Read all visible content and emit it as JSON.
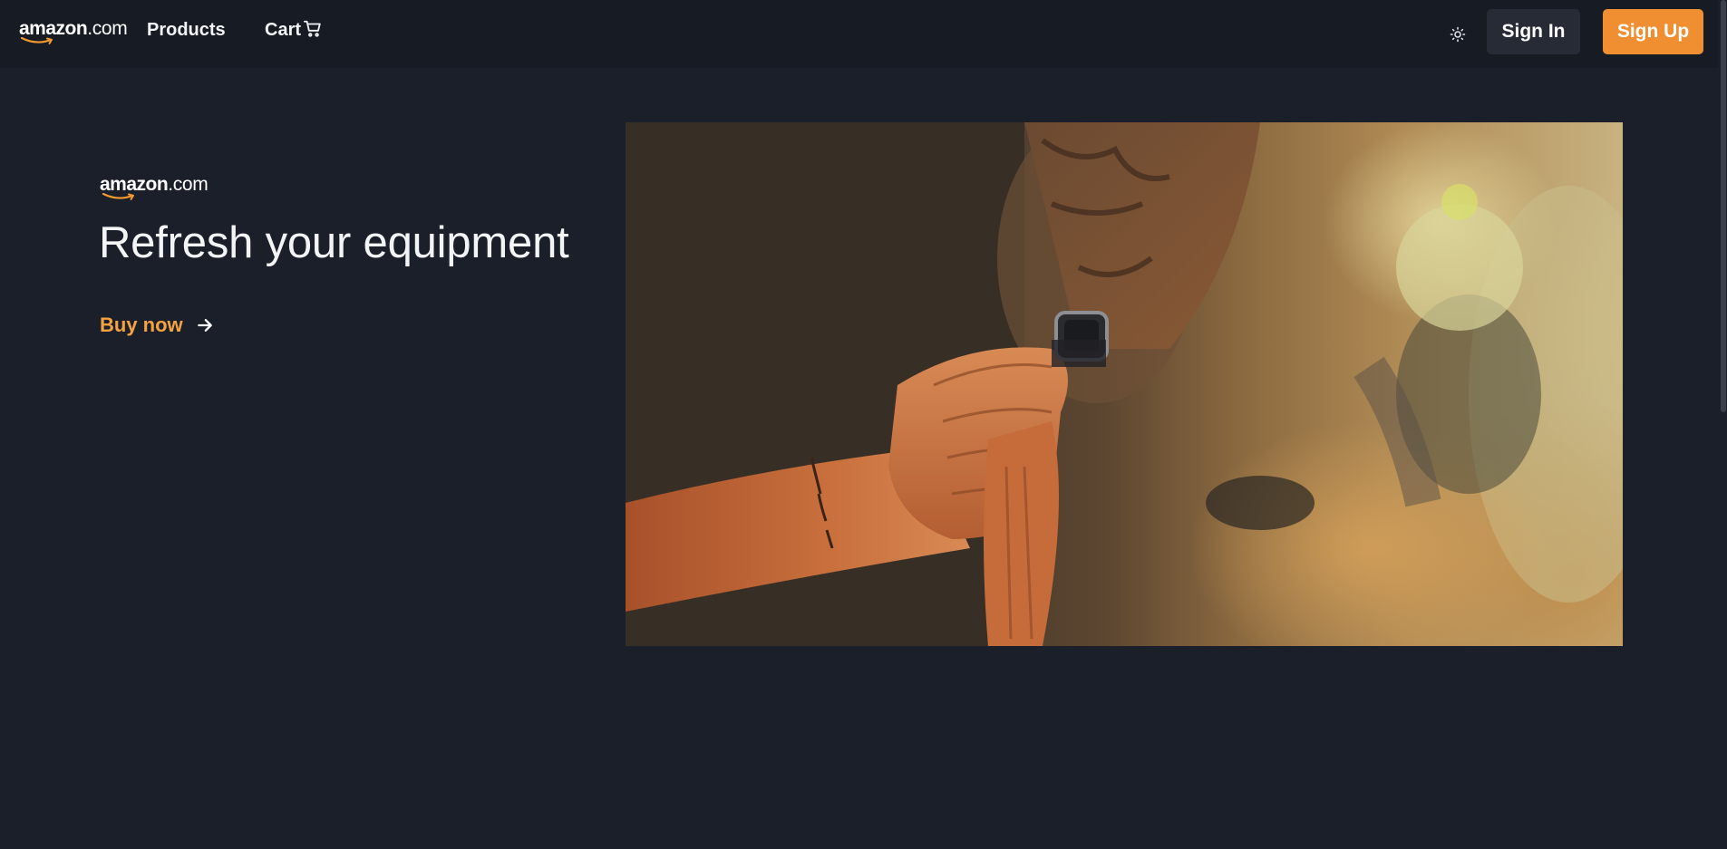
{
  "header": {
    "logo": {
      "name": "amazon",
      "suffix": ".com",
      "icon": "amazon-logo"
    },
    "nav": [
      {
        "label": "Products"
      },
      {
        "label": "Cart",
        "icon": "cart-icon"
      }
    ],
    "theme_toggle_icon": "sun-icon",
    "signin_label": "Sign In",
    "signup_label": "Sign Up"
  },
  "hero": {
    "logo": {
      "name": "amazon",
      "suffix": ".com"
    },
    "headline": "Refresh your equipment",
    "cta_label": "Buy now",
    "cta_icon": "arrow-right-icon",
    "image": "smartwatch-photo"
  },
  "colors": {
    "background": "#1b1f2a",
    "header_background": "#171b24",
    "accent": "#f08f32",
    "cta_text": "#f4a340",
    "signin_background": "#262b36",
    "logo_smile": "#f29a2e"
  }
}
